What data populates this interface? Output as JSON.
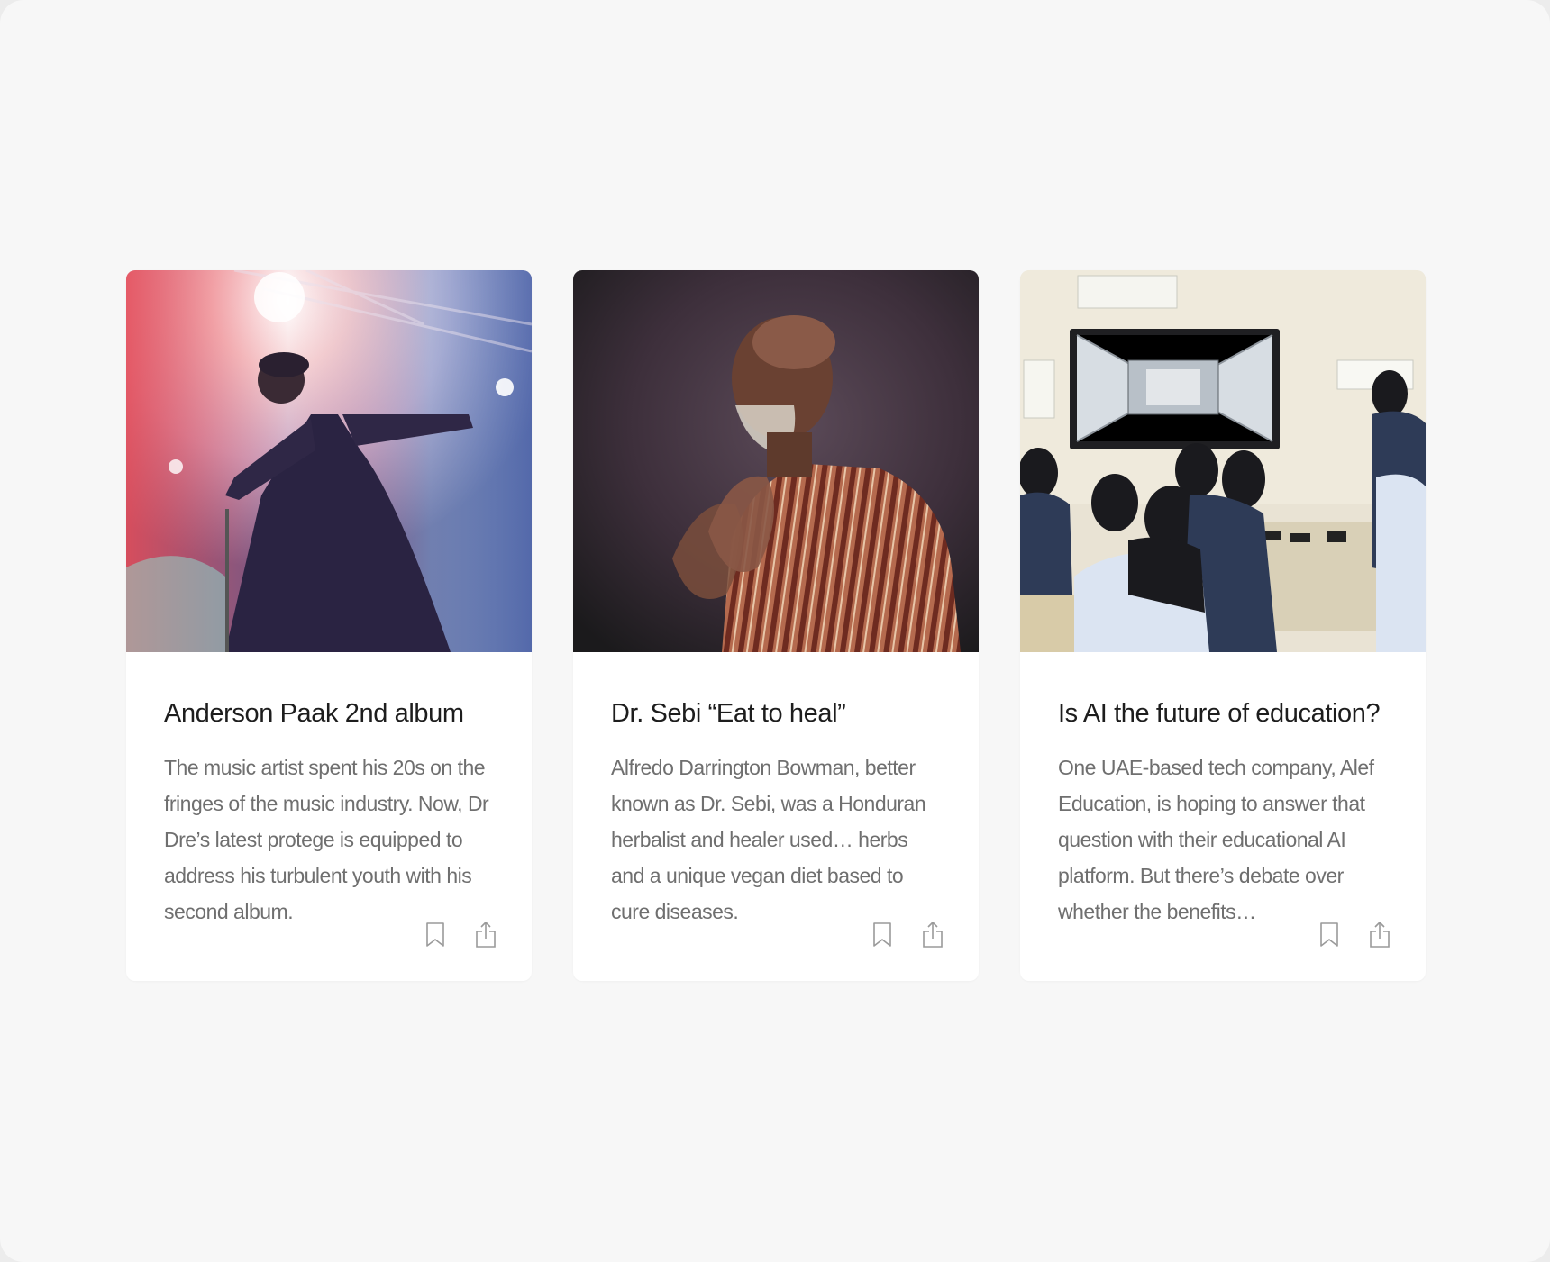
{
  "cards": [
    {
      "title": "Anderson Paak 2nd album",
      "description": "The music artist spent his 20s on the fringes of the music industry. Now, Dr Dre’s latest protege is equipped to address his turbulent youth with his second album.",
      "image_icon": "concert-photo",
      "actions": {
        "bookmark_icon": "bookmark-icon",
        "share_icon": "share-icon"
      }
    },
    {
      "title": "Dr. Sebi “Eat to heal”",
      "description": "Alfredo Darrington Bowman, better known as Dr. Sebi, was a Honduran herbalist and healer used… herbs and a unique vegan diet based to cure diseases.",
      "image_icon": "portrait-photo",
      "actions": {
        "bookmark_icon": "bookmark-icon",
        "share_icon": "share-icon"
      }
    },
    {
      "title": "Is AI the future of education?",
      "description": "One UAE-based tech company, Alef Education, is hoping to answer that question with their educational AI platform. But there’s debate over whether the benefits…",
      "image_icon": "classroom-photo",
      "actions": {
        "bookmark_icon": "bookmark-icon",
        "share_icon": "share-icon"
      }
    }
  ],
  "colors": {
    "page_background": "#f7f7f7",
    "card_background": "#ffffff",
    "title_text": "#1d1d1d",
    "body_text": "#6f6f6f",
    "icon_stroke": "#9a9a9a"
  }
}
